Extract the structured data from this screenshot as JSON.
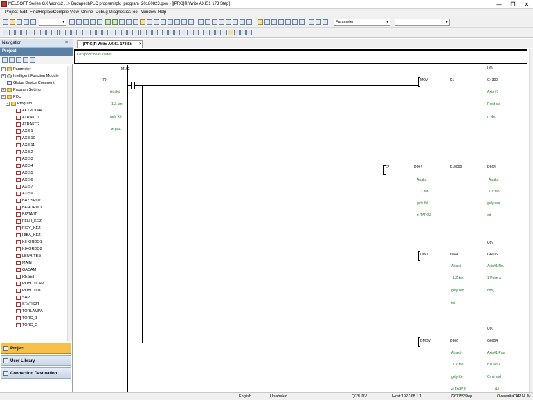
{
  "window": {
    "title": "MELSOFT Series GX Works2 ...> Budapest\\PLC program\\plc_program_20180823.gxw - [[PRG]R Write AXIS1 173 Step]",
    "controls": [
      "—",
      "❐",
      "✕"
    ]
  },
  "menu": [
    "Project",
    "Edit",
    "Find/Replace",
    "Compile",
    "View",
    "Online",
    "Debug",
    "Diagnostics",
    "Tool",
    "Window",
    "Help"
  ],
  "toolbar": {
    "combo_right": "Parameter"
  },
  "navigation": {
    "header": "Navigation",
    "section": "Project",
    "tree_top": [
      {
        "label": "Parameter",
        "icon": "folder-icon",
        "expander": "+"
      },
      {
        "label": "Intelligent Function Module",
        "icon": "gear-icon",
        "expander": "+"
      },
      {
        "label": "Global Device Comment",
        "icon": "doc-icon",
        "expander": ""
      },
      {
        "label": "Program Setting",
        "icon": "folder-icon",
        "expander": "+"
      },
      {
        "label": "POU",
        "icon": "folder-icon",
        "expander": "−"
      },
      {
        "label": "Program",
        "icon": "folder-icon",
        "expander": "−"
      }
    ],
    "programs": [
      "AKTPOLVA",
      "ATRAKO1",
      "ATRAKO2",
      "AXIS1",
      "AXIS10",
      "AXIS11",
      "AXIS2",
      "AXIS3",
      "AXIS4",
      "AXIS5",
      "AXIS6",
      "AXIS7",
      "AXIS9",
      "BAZISPOZ",
      "BEHORDO",
      "BIZTAJT",
      "FELH_KEZ",
      "FIGY_KEZ",
      "HIBA_KEZ",
      "KIHORDO1",
      "KIHORDO2",
      "LEURITES",
      "MAIN",
      "QACAM",
      "RESET",
      "ROBOTCAM",
      "ROBOTOK",
      "SAP",
      "STATISZT",
      "TORLAMPA",
      "TORO_1",
      "TORO_2"
    ],
    "tabs": [
      {
        "label": "Project",
        "active": true
      },
      {
        "label": "User Library",
        "active": false
      },
      {
        "label": "Connection Destination",
        "active": false
      }
    ]
  },
  "editor": {
    "tab_label": "[PRG]R Write AXIS1 173 St",
    "comment": "Kezi pozicionas kuldes",
    "rung_step": "79",
    "contact": {
      "device": "M102",
      "comments": [
        "Átrakó",
        "1.Z.tan",
        "gely Ké",
        "zi poz."
      ]
    },
    "instr1": {
      "op": "MOV",
      "src": "K1",
      "dst": "G4300",
      "uo": "U0\\",
      "dst_comments": [
        "Axis #1",
        "Posit sta",
        "rt No."
      ]
    },
    "instr2": {
      "op": "E*",
      "s1": "D904",
      "s2": "E10000",
      "dst": "D664",
      "s1_comments": [
        "Átrakó",
        "1.Z.tan",
        "gely Ké",
        "zi TAPOZ"
      ],
      "dst_comments": [
        "Átrakó",
        "1.Z.tan",
        "gely seq",
        "ed"
      ]
    },
    "instr3": {
      "op": "DINT",
      "src": "D664",
      "dst": "G6006",
      "uo": "U0\\",
      "src_comments": [
        "Átrakó",
        "1.Z.tan",
        "gely seq",
        "ed"
      ],
      "dst_comments": [
        "Axis#1 No.",
        "1 Posn a",
        "ddr(L)"
      ]
    },
    "instr4": {
      "op": "DMOV",
      "src": "D906",
      "dst": "G6004",
      "uo": "U0\\",
      "src_comments": [
        "Átrakó",
        "1.Z.tan",
        "gely Ké",
        "zi TASPE"
      ],
      "dst_comments": [
        "Axis#1 Pos",
        "n.d No.1",
        "Cmd spd",
        "(L)"
      ]
    }
  },
  "status": {
    "language": "English",
    "label": "Unlabeled",
    "cpu": "Q03UDV",
    "host": "Host:192.168.1.1",
    "step": "79/1759Step",
    "mode": "Overwrite",
    "caps": "CAP",
    "num": "NUM"
  }
}
